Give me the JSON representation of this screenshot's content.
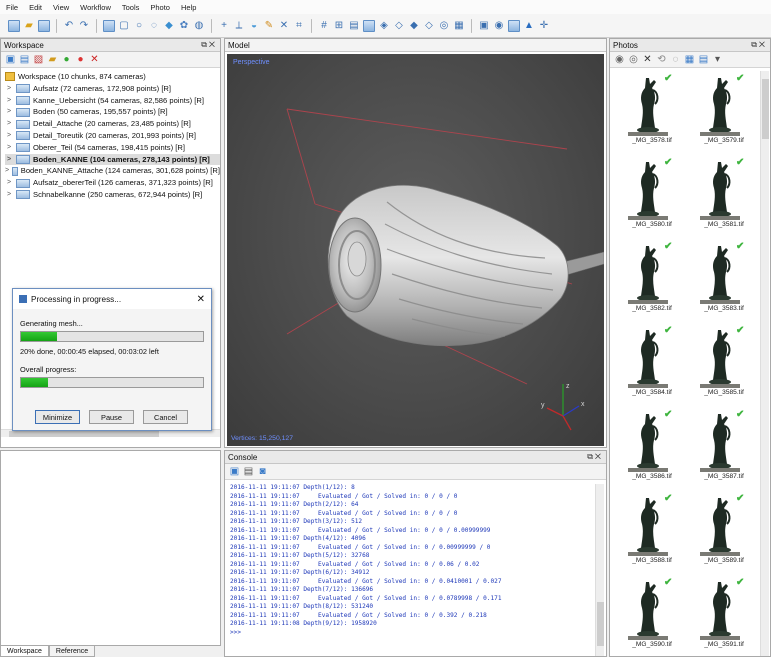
{
  "menu": [
    "File",
    "Edit",
    "View",
    "Workflow",
    "Tools",
    "Photo",
    "Help"
  ],
  "workspace_panel": {
    "title": "Workspace",
    "root_label": "Workspace (10 chunks, 874 cameras)",
    "chunks": [
      {
        "label": "Aufsatz (72 cameras, 172,908 points) [R]"
      },
      {
        "label": "Kanne_Uebersicht (54 cameras, 82,586 points) [R]"
      },
      {
        "label": "Boden (50 cameras, 195,557 points) [R]"
      },
      {
        "label": "Detail_Attache (20 cameras, 23,485 points) [R]"
      },
      {
        "label": "Detail_Toreutik (20 cameras, 201,993 points) [R]"
      },
      {
        "label": "Oberer_Teil (54 cameras, 198,415 points) [R]"
      },
      {
        "label": "Boden_KANNE (104 cameras, 278,143 points) [R]",
        "selected": true
      },
      {
        "label": "Boden_KANNE_Attache (124 cameras, 301,628 points) [R]"
      },
      {
        "label": "Aufsatz_obererTeil (126 cameras, 371,323 points) [R]"
      },
      {
        "label": "Schnabelkanne (250 cameras, 672,944 points) [R]"
      }
    ]
  },
  "dialog": {
    "title": "Processing in progress...",
    "task_label": "Generating mesh...",
    "task_progress": 0.2,
    "status_text": "20% done, 00:00:45 elapsed, 00:03:02 left",
    "overall_label": "Overall progress:",
    "overall_progress": 0.15,
    "buttons": {
      "minimize": "Minimize",
      "pause": "Pause",
      "cancel": "Cancel"
    }
  },
  "model_panel": {
    "title": "Model",
    "viewport_label": "Perspective",
    "footer_text": "Vertices: 15,250,127"
  },
  "console_panel": {
    "title": "Console",
    "lines": [
      "2016-11-11 19:11:07 Depth(1/12): 8",
      "2016-11-11 19:11:07     Evaluated / Got / Solved in: 0 / 0 / 0",
      "2016-11-11 19:11:07 Depth(2/12): 64",
      "2016-11-11 19:11:07     Evaluated / Got / Solved in: 0 / 0 / 0",
      "2016-11-11 19:11:07 Depth(3/12): 512",
      "2016-11-11 19:11:07     Evaluated / Got / Solved in: 0 / 0 / 0.00999999",
      "2016-11-11 19:11:07 Depth(4/12): 4096",
      "2016-11-11 19:11:07     Evaluated / Got / Solved in: 0 / 0.00999999 / 0",
      "2016-11-11 19:11:07 Depth(5/12): 32768",
      "2016-11-11 19:11:07     Evaluated / Got / Solved in: 0 / 0.06 / 0.02",
      "2016-11-11 19:11:07 Depth(6/12): 34912",
      "2016-11-11 19:11:07     Evaluated / Got / Solved in: 0 / 0.0410001 / 0.027",
      "2016-11-11 19:11:07 Depth(7/12): 136696",
      "2016-11-11 19:11:07     Evaluated / Got / Solved in: 0 / 0.0789998 / 0.171",
      "2016-11-11 19:11:07 Depth(8/12): 531240",
      "2016-11-11 19:11:07     Evaluated / Got / Solved in: 0 / 0.392 / 0.218",
      "2016-11-11 19:11:08 Depth(9/12): 1958920",
      ">>>"
    ]
  },
  "photos_panel": {
    "title": "Photos",
    "photos": [
      "_MG_3578.tif",
      "_MG_3579.tif",
      "_MG_3580.tif",
      "_MG_3581.tif",
      "_MG_3582.tif",
      "_MG_3583.tif",
      "_MG_3584.tif",
      "_MG_3585.tif",
      "_MG_3586.tif",
      "_MG_3587.tif",
      "_MG_3588.tif",
      "_MG_3589.tif",
      "_MG_3590.tif",
      "_MG_3591.tif"
    ]
  },
  "bottom_tabs": [
    "Workspace",
    "Reference"
  ],
  "colors": {
    "progress_green": "#1fae1f",
    "console_text": "#1d37b8",
    "viewport_bg": "#4e4e4e",
    "check_green": "#3fb53f"
  }
}
